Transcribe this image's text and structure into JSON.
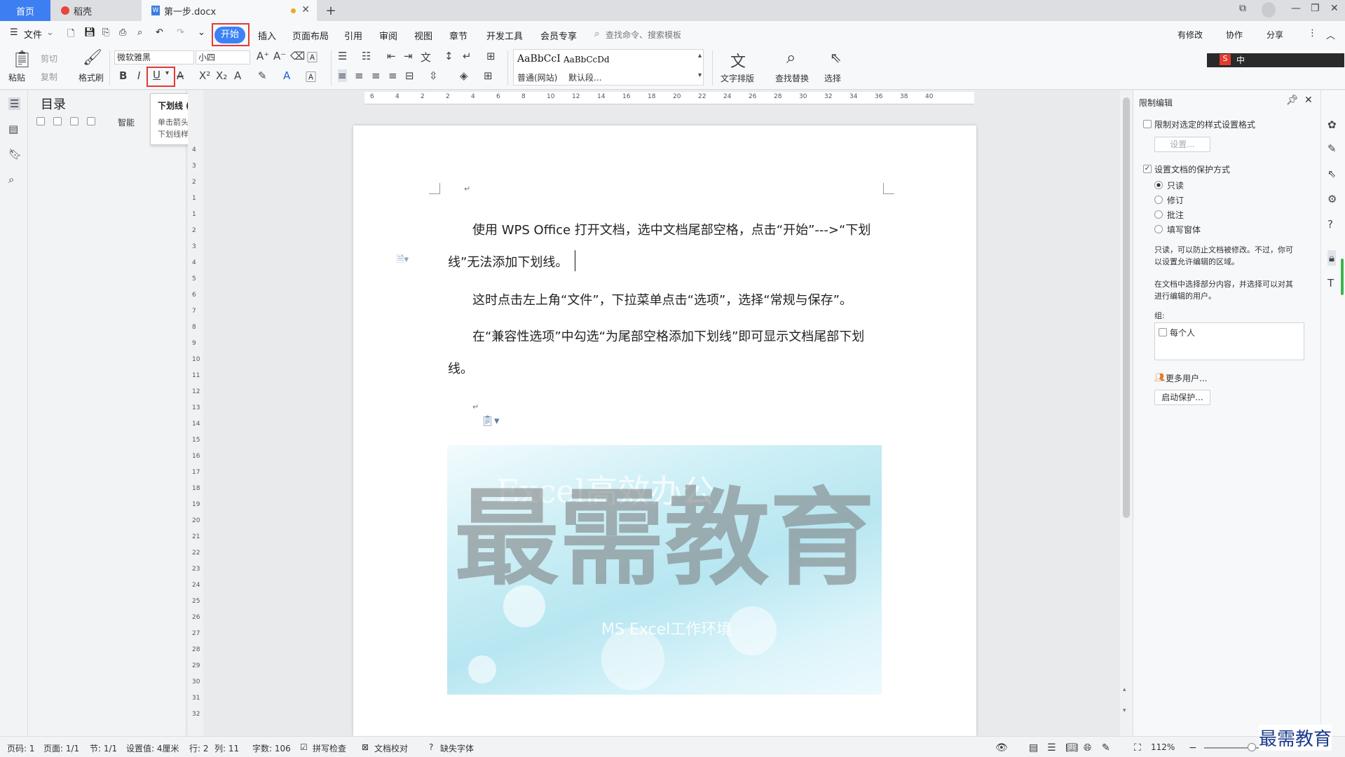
{
  "tabs": {
    "home": "首页",
    "daoke": "稻壳",
    "doc": "第一步.docx"
  },
  "menu": {
    "file": "文件",
    "items": [
      "开始",
      "插入",
      "页面布局",
      "引用",
      "审阅",
      "视图",
      "章节",
      "开发工具",
      "会员专享"
    ],
    "search": "查找命令、搜索模板",
    "right": [
      "有修改",
      "协作",
      "分享"
    ]
  },
  "ribbon": {
    "paste": "粘贴",
    "cut": "剪切",
    "copy": "复制",
    "format_painter": "格式刷",
    "font_name": "微软雅黑",
    "font_size": "小四",
    "style1_preview": "AaBbCcI",
    "style1_name": "普通(网站)",
    "style2_preview": "AaBbCcDd",
    "style2_name": "默认段...",
    "text_layout": "文字排版",
    "find_replace": "查找替换",
    "select": "选择"
  },
  "tooltip": {
    "title": "下划线 (Ctrl+U)",
    "desc1": "单击箭头可选择不同的",
    "desc2": "下划线样式。"
  },
  "toc": {
    "title": "目录",
    "smart": "智能"
  },
  "ruler_h": [
    "6",
    "4",
    "2",
    "2",
    "4",
    "6",
    "8",
    "10",
    "12",
    "14",
    "16",
    "18",
    "20",
    "22",
    "24",
    "26",
    "28",
    "30",
    "32",
    "34",
    "36",
    "38",
    "40"
  ],
  "ruler_v": [
    "4",
    "3",
    "2",
    "1",
    "1",
    "2",
    "3",
    "4",
    "5",
    "6",
    "7",
    "8",
    "9",
    "10",
    "11",
    "12",
    "13",
    "14",
    "15",
    "16",
    "17",
    "18",
    "19",
    "20",
    "21",
    "22",
    "23",
    "24",
    "25",
    "26",
    "27",
    "28",
    "29",
    "30",
    "31",
    "32"
  ],
  "document": {
    "para1_line1": "使用 WPS Office 打开文档，选中文档尾部空格，点击“开始”--->“下划",
    "para1_line2": "线”无法添加下划线。",
    "para2": "这时点击左上角“文件”，下拉菜单点击“选项”，选择“常规与保存”。",
    "para3_line1": "在“兼容性选项”中勾选“为尾部空格添加下划线”即可显示文档尾部下划",
    "para3_line2": "线。",
    "image_title": "Excel高效办公",
    "image_sub": "MS Excel工作环境",
    "watermark": "最需教育"
  },
  "restrict_panel": {
    "title": "限制编辑",
    "opt1": "限制对选定的样式设置格式",
    "settings_btn": "设置...",
    "opt2": "设置文档的保护方式",
    "radios": [
      "只读",
      "修订",
      "批注",
      "填写窗体"
    ],
    "desc1a": "只读，可以防止文档被修改。不过，你可",
    "desc1b": "以设置允许编辑的区域。",
    "desc2a": "在文档中选择部分内容，并选择可以对其",
    "desc2b": "进行编辑的用户。",
    "group_label": "组:",
    "everyone": "每个人",
    "more_users": "更多用户...",
    "start_protect": "启动保护..."
  },
  "status": {
    "page": "页码: 1",
    "pages": "页面: 1/1",
    "section": "节: 1/1",
    "setting": "设置值: 4厘米",
    "row": "行: 2",
    "col": "列: 11",
    "words": "字数: 106",
    "spell": "拼写检查",
    "proof": "文档校对",
    "missing_font": "缺失字体",
    "zoom": "112%"
  },
  "brand_watermark": "最需教育",
  "colors": {
    "accent": "#3b82f6",
    "highlight": "#e53935"
  }
}
